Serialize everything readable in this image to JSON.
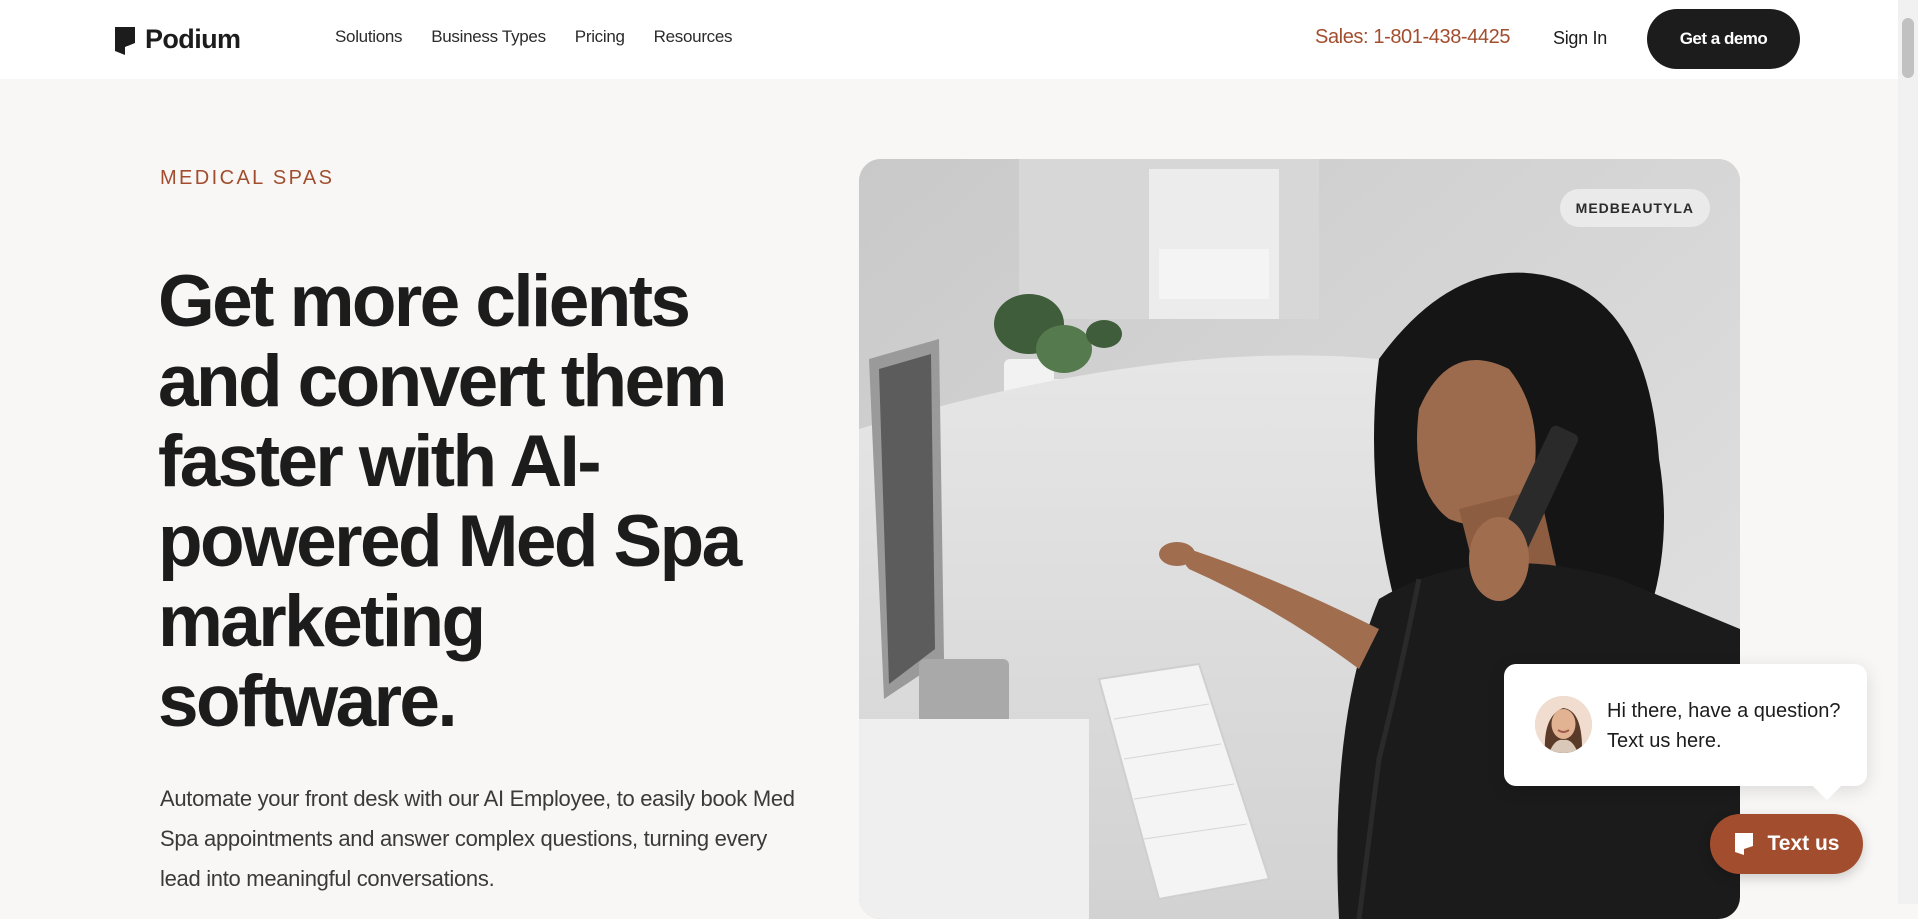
{
  "nav": {
    "logo_text": "Podium",
    "menu": [
      {
        "label": "Solutions"
      },
      {
        "label": "Business Types"
      },
      {
        "label": "Pricing"
      },
      {
        "label": "Resources"
      }
    ],
    "sales_text": "Sales: 1-801-438-4425",
    "sign_in": "Sign In",
    "demo_button": "Get a demo"
  },
  "hero": {
    "eyebrow": "MEDICAL SPAS",
    "headline": "Get more clients and convert them faster with AI-powered Med Spa marketing software.",
    "subcopy": "Automate your front desk with our AI Employee, to easily book Med Spa appointments and answer complex questions, turning every lead into meaningful conversations.",
    "image_badge": "MEDBEAUTYLA"
  },
  "chat": {
    "message": "Hi there, have a question? Text us here.",
    "button_label": "Text us"
  },
  "colors": {
    "accent": "#a24e2e",
    "dark": "#1c1c1c",
    "background": "#f8f7f5"
  },
  "icons": {
    "logo": "podium-flag-icon",
    "chat_button": "podium-chat-icon"
  }
}
